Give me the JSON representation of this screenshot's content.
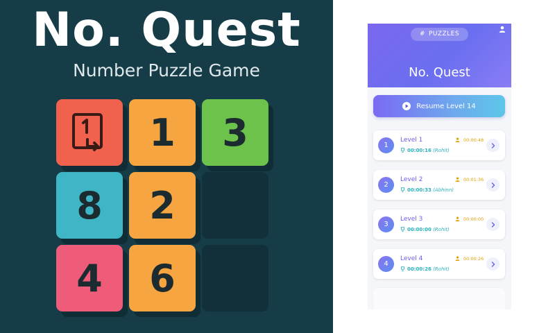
{
  "promo": {
    "title": "No. Quest",
    "subtitle": "Number Puzzle Game",
    "tiles": [
      {
        "label": "",
        "icon": "undo-level-icon",
        "color": "#f0614e"
      },
      {
        "label": "1",
        "color": "#f7a540"
      },
      {
        "label": "3",
        "color": "#6cc24a"
      },
      {
        "label": "8",
        "color": "#3fb6c6"
      },
      {
        "label": "2",
        "color": "#f7a540"
      },
      {
        "label": "",
        "empty": true
      },
      {
        "label": "4",
        "color": "#ee5c7a"
      },
      {
        "label": "6",
        "color": "#f7a540"
      },
      {
        "label": "",
        "empty": true
      }
    ]
  },
  "app": {
    "pill_label": "PUZZLES",
    "pill_icon": "hash-icon",
    "profile_icon": "user-icon",
    "title": "No. Quest",
    "resume_label": "Resume Level 14",
    "header_color": "#7b68ee",
    "accent_color": "#6a5cf0",
    "levels": [
      {
        "num": "1",
        "name": "Level 1",
        "user_time": "00:00:48",
        "best_time": "00:00:16",
        "best_by": "(Rohit)"
      },
      {
        "num": "2",
        "name": "Level 2",
        "user_time": "00:01:36",
        "best_time": "00:00:33",
        "best_by": "(Abhinn)"
      },
      {
        "num": "3",
        "name": "Level 3",
        "user_time": "00:00:00",
        "best_time": "00:00:00",
        "best_by": "(Rohit)"
      },
      {
        "num": "4",
        "name": "Level 4",
        "user_time": "00:00:26",
        "best_time": "00:00:26",
        "best_by": "(Rohit)"
      }
    ]
  }
}
